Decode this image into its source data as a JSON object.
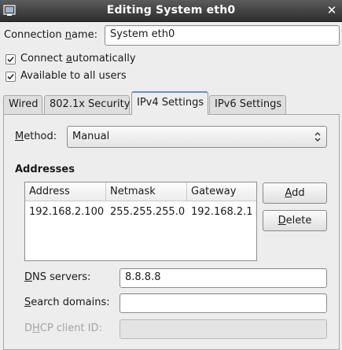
{
  "window": {
    "title": "Editing System eth0",
    "icon": "window-menu-icon",
    "close_icon": "close-icon"
  },
  "connection": {
    "name_label_pre": "Connection ",
    "name_label_ul": "n",
    "name_label_post": "ame:",
    "name_value": "System eth0",
    "connect_auto_pre": "Connect ",
    "connect_auto_ul": "a",
    "connect_auto_post": "utomatically",
    "connect_auto_checked": true,
    "all_users_label": "Available to all users",
    "all_users_checked": true
  },
  "tabs": [
    {
      "label": "Wired"
    },
    {
      "label": "802.1x Security"
    },
    {
      "label": "IPv4 Settings",
      "active": true
    },
    {
      "label": "IPv6 Settings"
    }
  ],
  "ipv4": {
    "method_label_pre": "",
    "method_label_ul": "M",
    "method_label_post": "ethod:",
    "method_value": "Manual",
    "addresses_heading": "Addresses",
    "columns": [
      "Address",
      "Netmask",
      "Gateway"
    ],
    "rows": [
      {
        "address": "192.168.2.100",
        "netmask": "255.255.255.0",
        "gateway": "192.168.2.1"
      }
    ],
    "add_ul": "A",
    "add_rest": "dd",
    "delete_ul": "D",
    "delete_rest": "elete",
    "dns_label_ul": "D",
    "dns_label_rest": "NS servers:",
    "dns_value": "8.8.8.8",
    "search_label_ul": "S",
    "search_label_rest": "earch domains:",
    "search_value": "",
    "dhcp_label_pre": "D",
    "dhcp_label_ul": "H",
    "dhcp_label_post": "CP client ID:",
    "dhcp_value": ""
  },
  "colors": {
    "titlebar": "#3a3a3a",
    "active_tab_accent": "#6d8fba"
  }
}
